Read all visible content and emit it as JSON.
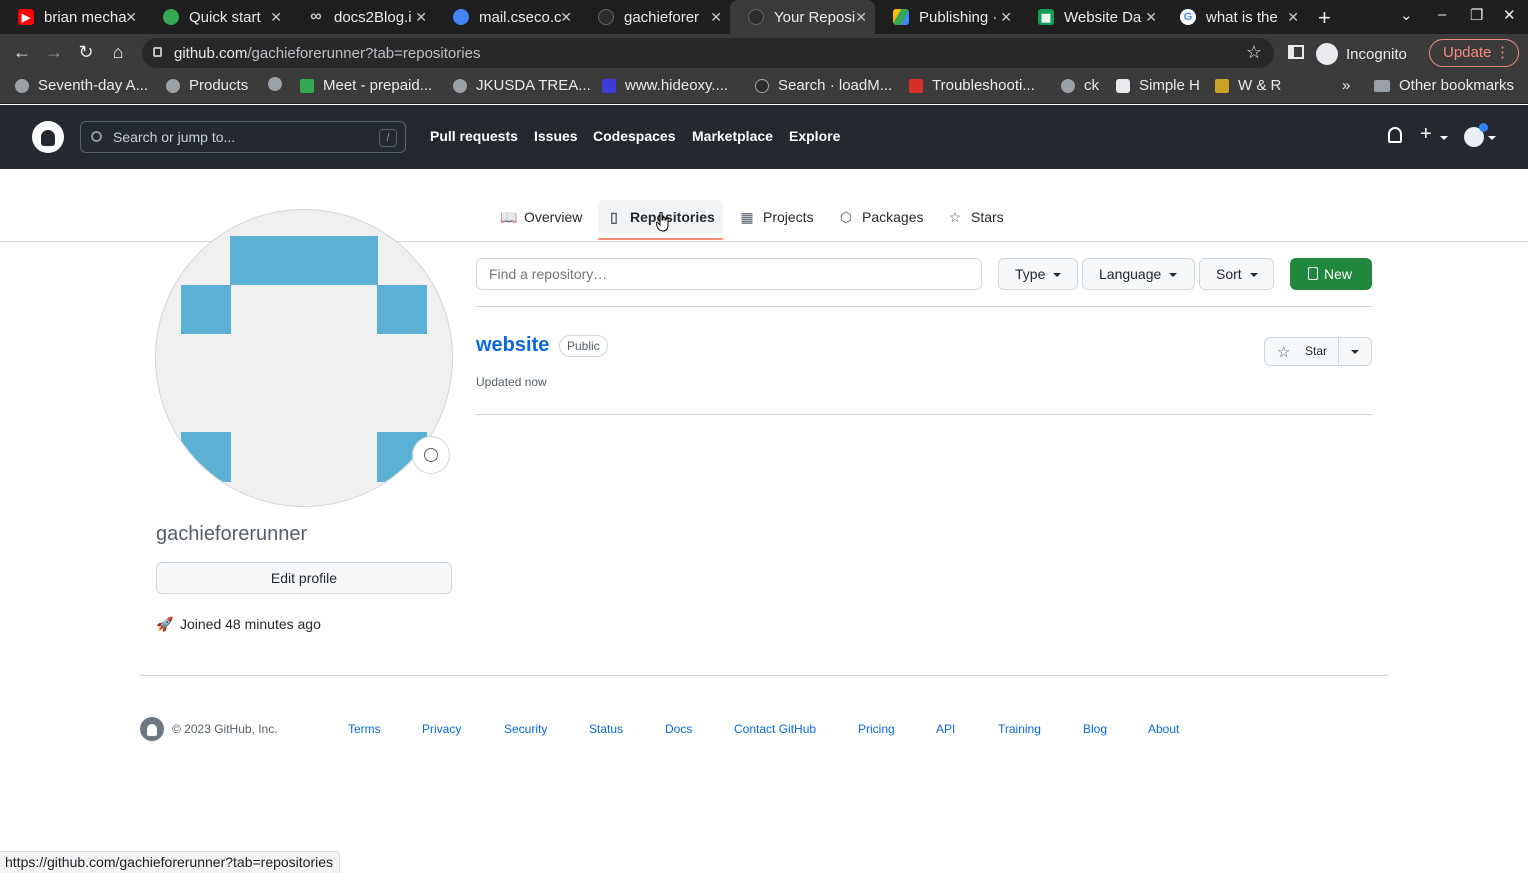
{
  "browser": {
    "tabs": [
      {
        "title": "brian mecha",
        "favicon_color": "#ff0000",
        "icon": "youtube-icon"
      },
      {
        "title": "Quick start",
        "favicon_color": "#34a853",
        "icon": "globe-icon"
      },
      {
        "title": "docs2Blog.i",
        "favicon_color": "#9aa0a6",
        "icon": "infinity-icon"
      },
      {
        "title": "mail.cseco.c",
        "favicon_color": "#4285f4",
        "icon": "mail-icon"
      },
      {
        "title": "gachieforer",
        "favicon_color": "#24292f",
        "icon": "github-icon"
      },
      {
        "title": "Your Reposi",
        "favicon_color": "#24292f",
        "icon": "github-icon"
      },
      {
        "title": "Publishing ·",
        "favicon_color": "#fbbc04",
        "icon": "drive-icon"
      },
      {
        "title": "Website Da",
        "favicon_color": "#0f9d58",
        "icon": "sheets-icon"
      },
      {
        "title": "what is the",
        "favicon_color": "#ffffff",
        "icon": "google-icon"
      }
    ],
    "active_tab_index": 5,
    "url_host": "github.com",
    "url_path": "/gachieforerunner?tab=repositories",
    "incognito_label": "Incognito",
    "update_label": "Update",
    "bookmarks": [
      {
        "label": "Seventh-day A..."
      },
      {
        "label": "Products"
      },
      {
        "label": ""
      },
      {
        "label": "Meet - prepaid..."
      },
      {
        "label": "JKUSDA TREA..."
      },
      {
        "label": "www.hideoxy...."
      },
      {
        "label": "Search · loadM..."
      },
      {
        "label": "Troubleshooti..."
      },
      {
        "label": "ck"
      },
      {
        "label": "Simple H"
      },
      {
        "label": "W & R"
      }
    ],
    "bookmarks_overflow": "»",
    "other_bookmarks": "Other bookmarks",
    "status_url": "https://github.com/gachieforerunner?tab=repositories"
  },
  "github_header": {
    "search_placeholder": "Search or jump to...",
    "search_shortcut": "/",
    "nav": [
      "Pull requests",
      "Issues",
      "Codespaces",
      "Marketplace",
      "Explore"
    ]
  },
  "profile_tabs": [
    {
      "label": "Overview",
      "icon": "book-icon"
    },
    {
      "label": "Repositories",
      "icon": "repo-icon"
    },
    {
      "label": "Projects",
      "icon": "table-icon"
    },
    {
      "label": "Packages",
      "icon": "package-icon"
    },
    {
      "label": "Stars",
      "icon": "star-icon"
    }
  ],
  "selected_profile_tab": "Repositories",
  "profile": {
    "username": "gachieforerunner",
    "edit_profile_label": "Edit profile",
    "joined_text": "Joined 48 minutes ago",
    "avatar_color": "#5ab1d3"
  },
  "repo_filters": {
    "find_placeholder": "Find a repository…",
    "type_label": "Type",
    "language_label": "Language",
    "sort_label": "Sort",
    "new_label": "New"
  },
  "repositories": [
    {
      "name": "website",
      "visibility": "Public",
      "updated": "Updated now",
      "star_label": "Star"
    }
  ],
  "footer": {
    "copyright": "© 2023 GitHub, Inc.",
    "links": [
      "Terms",
      "Privacy",
      "Security",
      "Status",
      "Docs",
      "Contact GitHub",
      "Pricing",
      "API",
      "Training",
      "Blog",
      "About"
    ]
  }
}
